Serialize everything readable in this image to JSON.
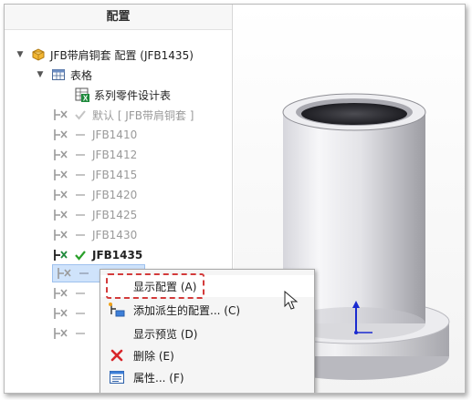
{
  "panel": {
    "title": "配置",
    "root_label": "JFB带肩铜套 配置  (JFB1435)",
    "table_folder": "表格",
    "design_table": "系列零件设计表",
    "configs": [
      {
        "label": "默认 [ JFB带肩铜套 ]",
        "active": false
      },
      {
        "label": "JFB1410",
        "active": false
      },
      {
        "label": "JFB1412",
        "active": false
      },
      {
        "label": "JFB1415",
        "active": false
      },
      {
        "label": "JFB1420",
        "active": false
      },
      {
        "label": "JFB1425",
        "active": false
      },
      {
        "label": "JFB1430",
        "active": false
      },
      {
        "label": "JFB1435",
        "active": true
      }
    ]
  },
  "context_menu": {
    "items": [
      {
        "label": "显示配置 (A)",
        "icon": "none"
      },
      {
        "label": "添加派生的配置... (C)",
        "icon": "derived-config-icon"
      },
      {
        "label": "显示预览 (D)",
        "icon": "none"
      },
      {
        "label": "删除 (E)",
        "icon": "delete-icon"
      },
      {
        "label": "属性... (F)",
        "icon": "properties-icon"
      }
    ]
  },
  "colors": {
    "active_check": "#2aa02a",
    "inactive": "#9a9a9a",
    "delete_red": "#d8262a",
    "highlight_border": "#d33b3b"
  }
}
